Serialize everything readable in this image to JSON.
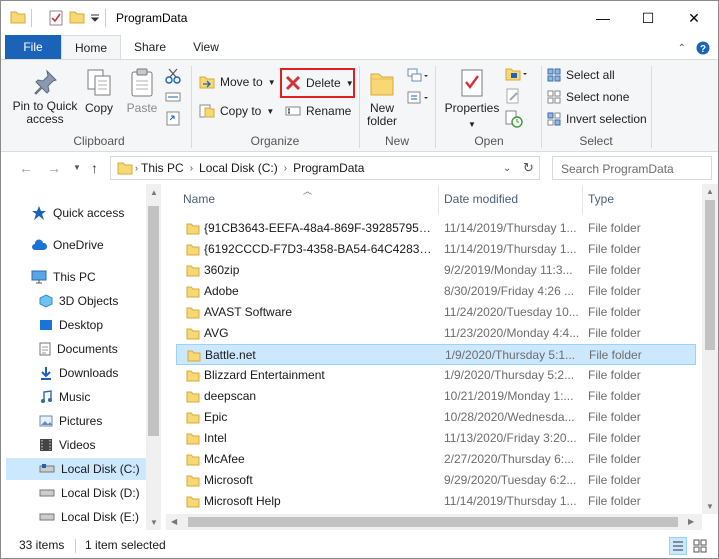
{
  "window": {
    "title": "ProgramData",
    "minimize_glyph": "—",
    "maximize_glyph": "☐",
    "close_glyph": "✕"
  },
  "ribbon_tabs": [
    "File",
    "Home",
    "Share",
    "View"
  ],
  "ribbon": {
    "clipboard": {
      "label": "Clipboard",
      "pin_label": "Pin to Quick access",
      "copy_label": "Copy",
      "paste_label": "Paste"
    },
    "organize": {
      "label": "Organize",
      "move_to": "Move to",
      "copy_to": "Copy to",
      "delete": "Delete",
      "rename": "Rename"
    },
    "new": {
      "label": "New",
      "new_folder": "New folder"
    },
    "open": {
      "label": "Open",
      "properties": "Properties"
    },
    "select": {
      "label": "Select",
      "select_all": "Select all",
      "select_none": "Select none",
      "invert_selection": "Invert selection"
    }
  },
  "address": {
    "crumbs": [
      "This PC",
      "Local Disk (C:)",
      "ProgramData"
    ],
    "search_placeholder": "Search ProgramData"
  },
  "nav_pane": {
    "items": [
      {
        "label": "Quick access",
        "icon": "star-icon"
      },
      {
        "label": "OneDrive",
        "icon": "cloud-icon"
      },
      {
        "label": "This PC",
        "icon": "computer-icon"
      },
      {
        "label": "3D Objects",
        "icon": "cube-icon"
      },
      {
        "label": "Desktop",
        "icon": "desktop-icon"
      },
      {
        "label": "Documents",
        "icon": "document-icon"
      },
      {
        "label": "Downloads",
        "icon": "download-icon"
      },
      {
        "label": "Music",
        "icon": "music-icon"
      },
      {
        "label": "Pictures",
        "icon": "picture-icon"
      },
      {
        "label": "Videos",
        "icon": "video-icon"
      },
      {
        "label": "Local Disk (C:)",
        "icon": "drive-icon"
      },
      {
        "label": "Local Disk (D:)",
        "icon": "drive-icon"
      },
      {
        "label": "Local Disk  (E:)",
        "icon": "drive-icon"
      }
    ]
  },
  "file_list": {
    "columns": [
      "Name",
      "Date modified",
      "Type"
    ],
    "rows": [
      {
        "name": "{91CB3643-EEFA-48a4-869F-39285795D61...",
        "date": "11/14/2019/Thursday 1...",
        "type": "File folder"
      },
      {
        "name": "{6192CCCD-F7D3-4358-BA54-64C42833A...",
        "date": "11/14/2019/Thursday 1...",
        "type": "File folder"
      },
      {
        "name": "360zip",
        "date": "9/2/2019/Monday 11:3...",
        "type": "File folder"
      },
      {
        "name": "Adobe",
        "date": "8/30/2019/Friday 4:26 ...",
        "type": "File folder"
      },
      {
        "name": "AVAST Software",
        "date": "11/24/2020/Tuesday 10...",
        "type": "File folder"
      },
      {
        "name": "AVG",
        "date": "11/23/2020/Monday 4:4...",
        "type": "File folder"
      },
      {
        "name": "Battle.net",
        "date": "1/9/2020/Thursday 5:1...",
        "type": "File folder"
      },
      {
        "name": "Blizzard Entertainment",
        "date": "1/9/2020/Thursday 5:2...",
        "type": "File folder"
      },
      {
        "name": "deepscan",
        "date": "10/21/2019/Monday 1:...",
        "type": "File folder"
      },
      {
        "name": "Epic",
        "date": "10/28/2020/Wednesda...",
        "type": "File folder"
      },
      {
        "name": "Intel",
        "date": "11/13/2020/Friday 3:20...",
        "type": "File folder"
      },
      {
        "name": "McAfee",
        "date": "2/27/2020/Thursday 6:...",
        "type": "File folder"
      },
      {
        "name": "Microsoft",
        "date": "9/29/2020/Tuesday 6:2...",
        "type": "File folder"
      },
      {
        "name": "Microsoft Help",
        "date": "11/14/2019/Thursday 1...",
        "type": "File folder"
      }
    ]
  },
  "status": {
    "items_count": "33 items",
    "selected": "1 item selected"
  },
  "colors": {
    "accent": "#1a63b8",
    "selection": "#cce8ff",
    "folder": "#f8d775",
    "delete_highlight": "#e02020"
  }
}
